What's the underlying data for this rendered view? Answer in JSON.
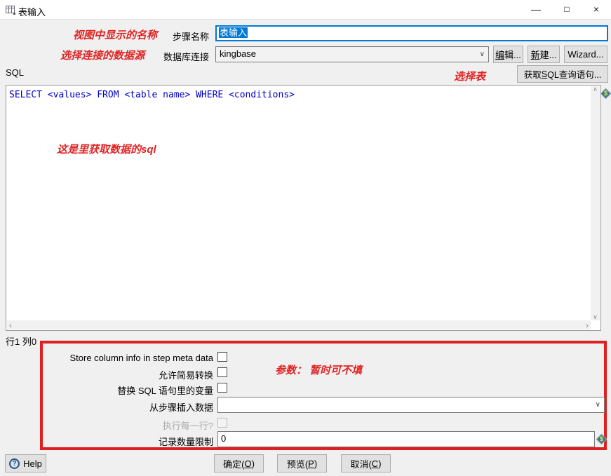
{
  "window": {
    "title": "表输入"
  },
  "icons": {
    "minimize": "—",
    "maximize": "□",
    "close": "×",
    "chevron_down": "∨",
    "scroll_up": "∧",
    "scroll_down": "∨",
    "scroll_left": "‹",
    "scroll_right": "›",
    "variable_dollar": "$",
    "help_question": "?"
  },
  "annotations": {
    "step_name_note": "视图中显示的名称",
    "connection_note": "选择连接的数据源",
    "select_table_note": "选择表",
    "sql_note": "这是里获取数据的sql",
    "params_note": "参数： 暂时可不填"
  },
  "form": {
    "step_name": {
      "label": "步骤名称",
      "value": "表输入"
    },
    "connection": {
      "label": "数据库连接",
      "value": "kingbase",
      "edit_btn": {
        "mn": "编",
        "post": "辑..."
      },
      "new_btn": {
        "mn": "新",
        "post": "建..."
      },
      "wizard_btn": "Wizard..."
    },
    "sql": {
      "label": "SQL",
      "get_sql_btn": {
        "pre": "获取",
        "mn": "S",
        "post": "QL查询语句..."
      },
      "content": "SELECT <values> FROM <table name> WHERE <conditions>"
    },
    "status": "行1 列0",
    "options": {
      "store_meta_label": "Store column info in step meta data",
      "lazy_conversion_label": "允许简易转换",
      "replace_vars_label": "替换 SQL 语句里的变量",
      "insert_data_label": "从步骤插入数据",
      "insert_data_value": "",
      "execute_each_row_label": "执行每一行?",
      "limit_label": "记录数量限制",
      "limit_value": "0"
    }
  },
  "footer": {
    "help_label": "Help",
    "ok": {
      "pre": "确定(",
      "mn": "O",
      "post": ")"
    },
    "preview": {
      "pre": "预览(",
      "mn": "P",
      "post": ")"
    },
    "cancel": {
      "pre": "取消(",
      "mn": "C",
      "post": ")"
    }
  },
  "colors": {
    "accent": "#0078d7",
    "annotation_red": "#e02424",
    "box_red": "#df2020",
    "sql_text_blue": "#0000cc"
  }
}
